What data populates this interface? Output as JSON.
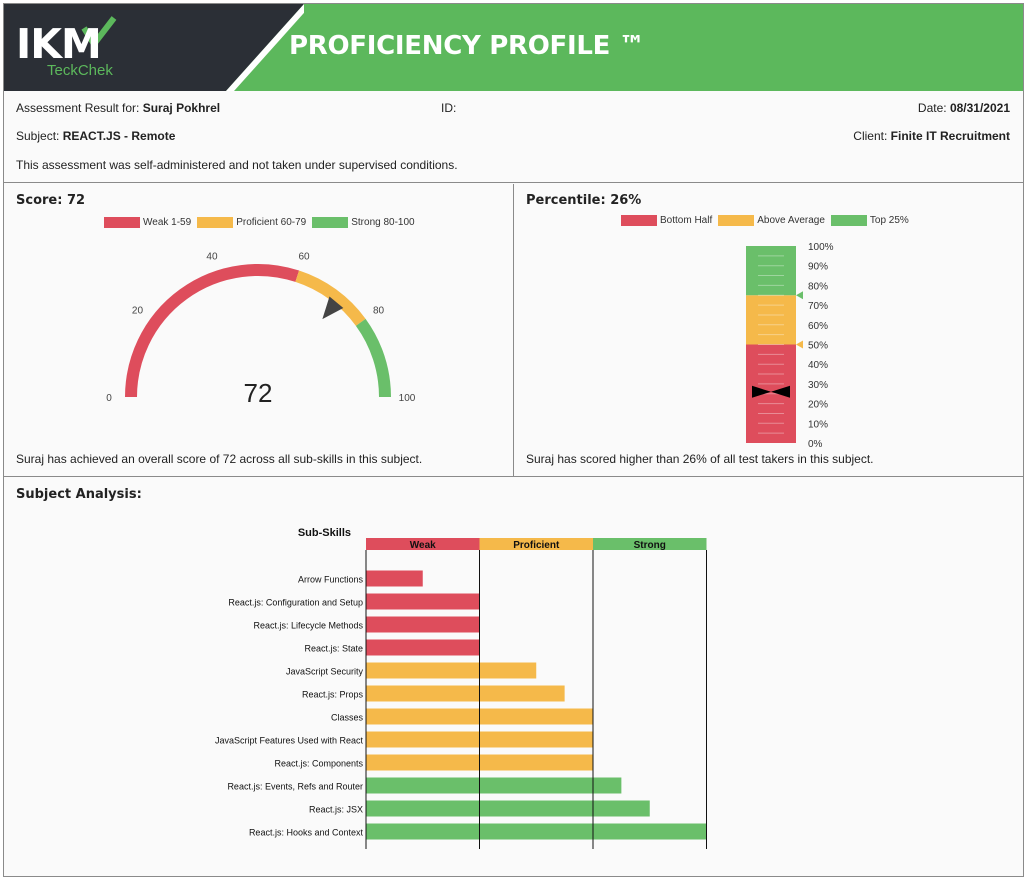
{
  "header": {
    "logo": "IKM",
    "logo_sub": "TeckChek",
    "title": "PROFICIENCY PROFILE ™"
  },
  "info": {
    "result_label": "Assessment Result for:",
    "candidate": "Suraj Pokhrel",
    "id_label": "ID:",
    "date_label": "Date:",
    "date": "08/31/2021",
    "subject_label": "Subject:",
    "subject": "REACT.JS - Remote",
    "client_label": "Client:",
    "client": "Finite IT Recruitment",
    "note": "This assessment was self-administered and not taken under supervised conditions."
  },
  "score": {
    "title": "Score: 72",
    "legend": [
      "Weak 1-59",
      "Proficient 60-79",
      "Strong 80-100"
    ],
    "value_text": "72",
    "footnote": "Suraj has achieved an overall score of 72 across all sub-skills in this subject."
  },
  "percentile": {
    "title": "Percentile: 26%",
    "legend": [
      "Bottom Half",
      "Above Average",
      "Top 25%"
    ],
    "footnote": "Suraj has scored higher than 26% of all test takers in this subject."
  },
  "subject": {
    "title": "Subject Analysis:"
  },
  "colors": {
    "weak": "#de4d5c",
    "proficient": "#f5b94a",
    "strong": "#6abf6a",
    "header_green": "#5cb85c",
    "logo_dark": "#2b2f36"
  },
  "chart_data": [
    {
      "type": "gauge",
      "value": 72,
      "range": [
        0,
        100
      ],
      "ticks": [
        "0",
        "20",
        "40",
        "60",
        "80",
        "100"
      ],
      "bands": [
        {
          "name": "Weak 1-59",
          "from": 0,
          "to": 60
        },
        {
          "name": "Proficient 60-79",
          "from": 60,
          "to": 80
        },
        {
          "name": "Strong 80-100",
          "from": 80,
          "to": 100
        }
      ]
    },
    {
      "type": "bar",
      "orientation": "vertical-stacked",
      "value": 26,
      "ticks": [
        "0%",
        "10%",
        "20%",
        "30%",
        "40%",
        "50%",
        "60%",
        "70%",
        "80%",
        "90%",
        "100%"
      ],
      "bands": [
        {
          "name": "Bottom Half",
          "from": 0,
          "to": 50
        },
        {
          "name": "Above Average",
          "from": 50,
          "to": 75
        },
        {
          "name": "Top 25%",
          "from": 75,
          "to": 100
        }
      ]
    },
    {
      "type": "bar",
      "orientation": "horizontal",
      "ylabel": "Sub-Skills",
      "zones": [
        "Weak",
        "Proficient",
        "Strong"
      ],
      "categories": [
        "Arrow Functions",
        "React.js: Configuration and Setup",
        "React.js: Lifecycle Methods",
        "React.js: State",
        "JavaScript Security",
        "React.js: Props",
        "Classes",
        "JavaScript Features Used with React",
        "React.js: Components",
        "React.js: Events, Refs and Router",
        "React.js: JSX",
        "React.js: Hooks and Context"
      ],
      "values": [
        0.5,
        1.0,
        1.0,
        1.0,
        1.5,
        1.75,
        2.0,
        2.0,
        2.0,
        2.25,
        2.5,
        3.0
      ],
      "levels": [
        "Weak",
        "Weak",
        "Weak",
        "Weak",
        "Proficient",
        "Proficient",
        "Proficient",
        "Proficient",
        "Proficient",
        "Strong",
        "Strong",
        "Strong"
      ],
      "xlim": [
        0,
        3
      ]
    }
  ]
}
